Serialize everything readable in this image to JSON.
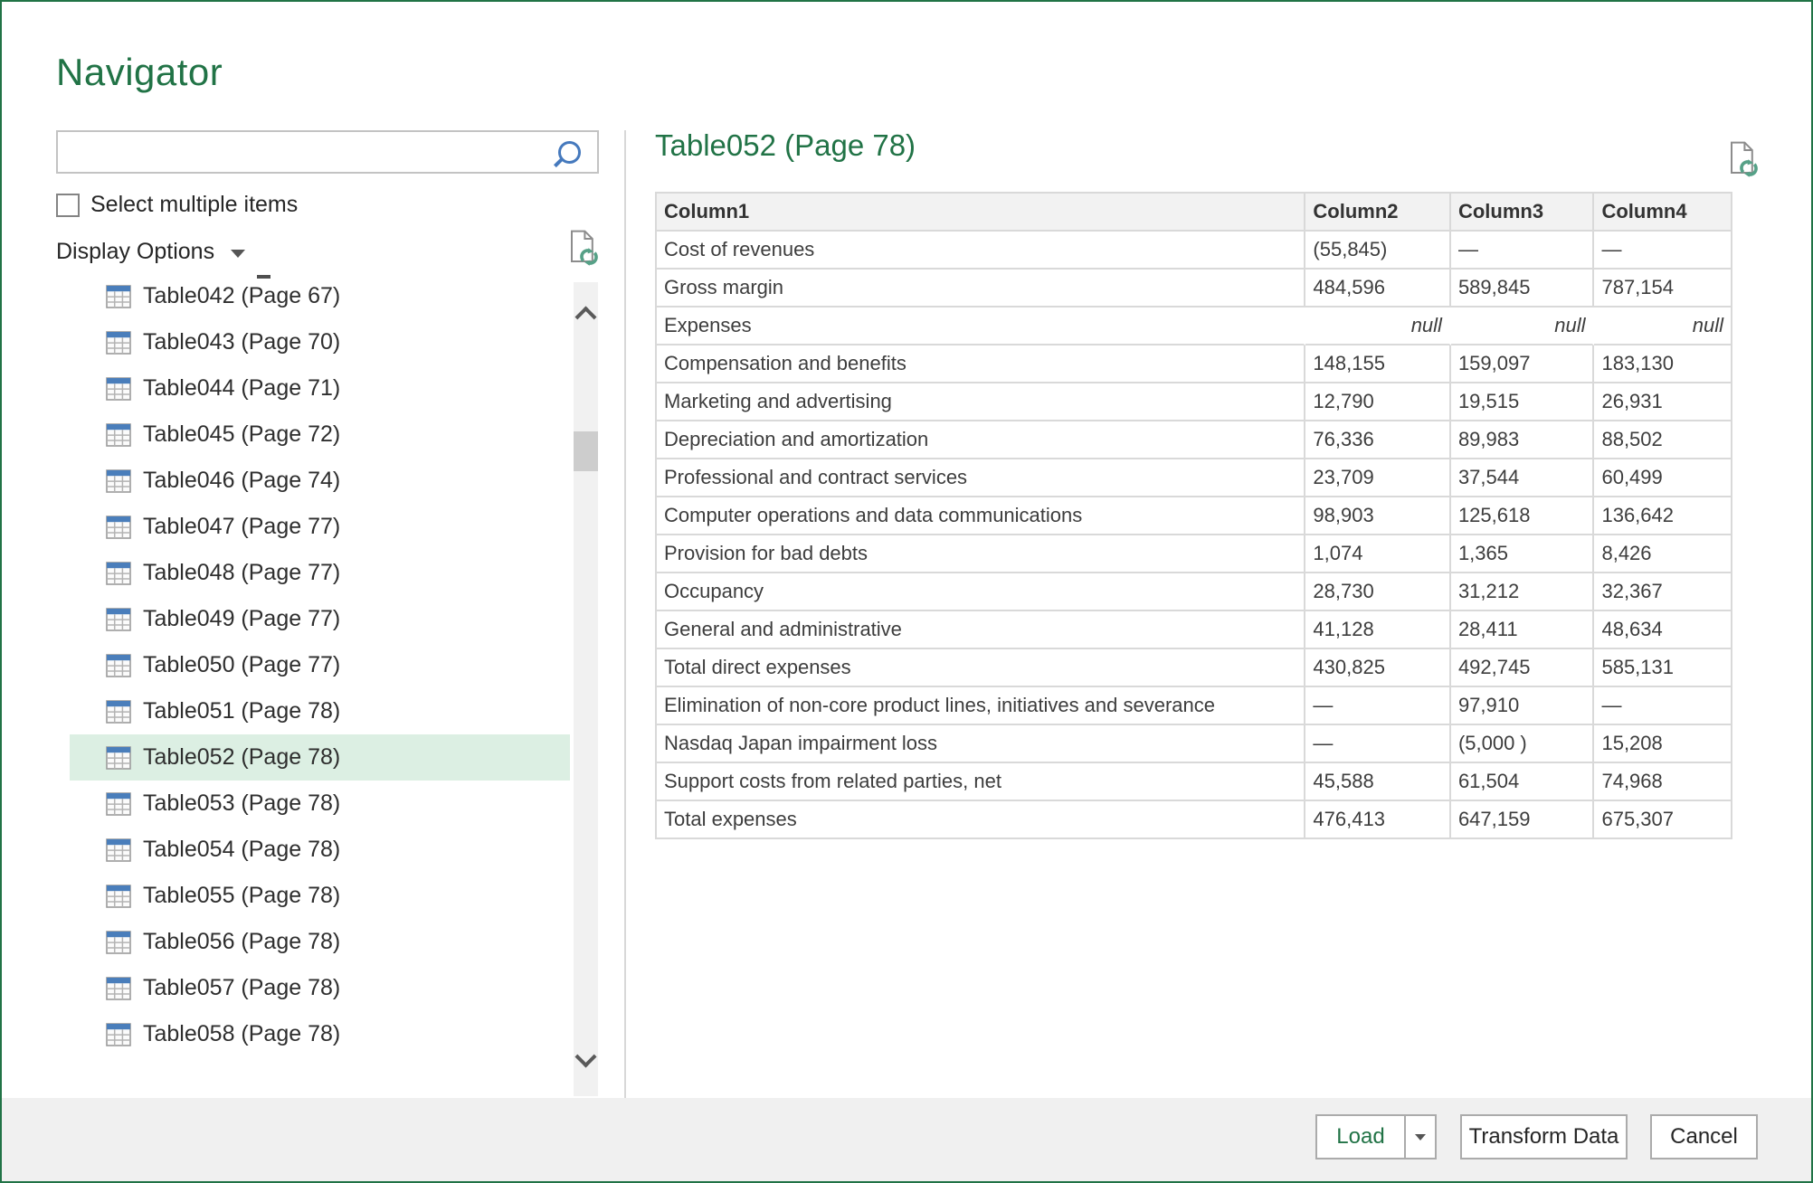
{
  "window": {
    "controls": {
      "maximize": "maximize",
      "close": "close"
    }
  },
  "navigator": {
    "title": "Navigator",
    "search_placeholder": "",
    "search_value": "",
    "select_multiple_label": "Select multiple items",
    "select_multiple_checked": false,
    "display_options_label": "Display Options"
  },
  "table_list": {
    "items": [
      "Table042 (Page 67)",
      "Table043 (Page 70)",
      "Table044 (Page 71)",
      "Table045 (Page 72)",
      "Table046 (Page 74)",
      "Table047 (Page 77)",
      "Table048 (Page 77)",
      "Table049 (Page 77)",
      "Table050 (Page 77)",
      "Table051 (Page 78)",
      "Table052 (Page 78)",
      "Table053 (Page 78)",
      "Table054 (Page 78)",
      "Table055 (Page 78)",
      "Table056 (Page 78)",
      "Table057 (Page 78)",
      "Table058 (Page 78)"
    ],
    "selected_index": 10,
    "selected_item": "Table052 (Page 78)"
  },
  "preview": {
    "title": "Table052 (Page 78)",
    "columns": [
      "Column1",
      "Column2",
      "Column3",
      "Column4"
    ],
    "rows": [
      [
        "Cost of revenues",
        "(55,845)",
        "—",
        "—"
      ],
      [
        "Gross margin",
        "484,596",
        "589,845",
        "787,154"
      ],
      [
        "Expenses",
        "null",
        "null",
        "null"
      ],
      [
        "Compensation and benefits",
        "148,155",
        "159,097",
        "183,130"
      ],
      [
        "Marketing and advertising",
        "12,790",
        "19,515",
        "26,931"
      ],
      [
        "Depreciation and amortization",
        "76,336",
        "89,983",
        "88,502"
      ],
      [
        "Professional and contract services",
        "23,709",
        "37,544",
        "60,499"
      ],
      [
        "Computer operations and data communications",
        "98,903",
        "125,618",
        "136,642"
      ],
      [
        "Provision for bad debts",
        "1,074",
        "1,365",
        "8,426"
      ],
      [
        "Occupancy",
        "28,730",
        "31,212",
        "32,367"
      ],
      [
        "General and administrative",
        "41,128",
        "28,411",
        "48,634"
      ],
      [
        "Total direct expenses",
        "430,825",
        "492,745",
        "585,131"
      ],
      [
        "Elimination of non-core product lines, initiatives and severance",
        "—",
        "97,910",
        "—"
      ],
      [
        "Nasdaq Japan impairment loss",
        "—",
        "(5,000 )",
        "15,208"
      ],
      [
        "Support costs from related parties, net",
        "45,588",
        "61,504",
        "74,968"
      ],
      [
        "Total expenses",
        "476,413",
        "647,159",
        "675,307"
      ]
    ]
  },
  "footer": {
    "load_label": "Load",
    "transform_label": "Transform Data",
    "cancel_label": "Cancel"
  },
  "colors": {
    "accent_green": "#217346",
    "selected_item_bg": "#DCEFE3",
    "table_icon_blue": "#4A7EBB",
    "refresh_green": "#56A187",
    "search_icon_blue": "#4579BD",
    "footer_bg": "#F0F0F0",
    "table_border": "#D9D9D9",
    "header_bg": "#F2F2F2"
  },
  "icons": {
    "search": "search-icon",
    "refresh_file": "refresh-file-icon",
    "table": "table-icon"
  }
}
